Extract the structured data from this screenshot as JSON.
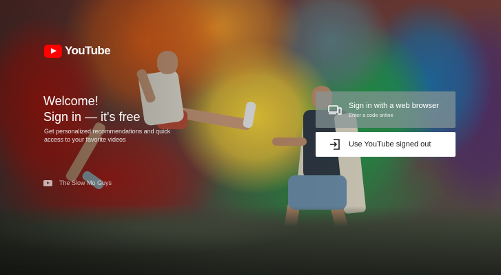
{
  "brand": {
    "name": "YouTube",
    "accent": "#ff0000"
  },
  "welcome": {
    "line1": "Welcome!",
    "line2": "Sign in — it's free"
  },
  "subtitle": "Get personalized recommendations and quick access to your favorite videos",
  "credit": {
    "icon": "youtube-icon",
    "text": "The Slow Mo Guys"
  },
  "buttons": {
    "browser": {
      "icon": "devices-icon",
      "title": "Sign in with a web browser",
      "subtitle": "Enter a code online"
    },
    "signed_out": {
      "icon": "sign-in-arrow-icon",
      "title": "Use YouTube signed out"
    }
  }
}
